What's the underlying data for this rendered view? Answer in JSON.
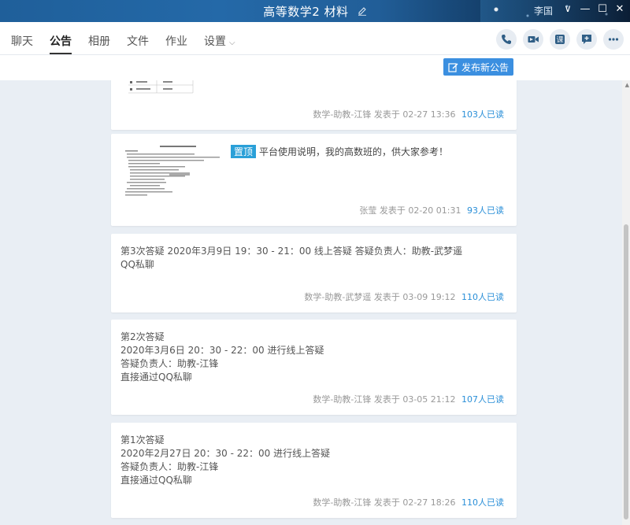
{
  "window": {
    "title": "高等数学2 材料",
    "user": "李国",
    "controls": [
      "∨",
      "—",
      "☐",
      "✕"
    ]
  },
  "tabs": [
    {
      "label": "聊天"
    },
    {
      "label": "公告"
    },
    {
      "label": "相册"
    },
    {
      "label": "文件"
    },
    {
      "label": "作业"
    },
    {
      "label": "设置"
    }
  ],
  "actions": [
    "phone-icon",
    "video-icon",
    "course-icon",
    "add-comment-icon",
    "more-icon"
  ],
  "publish": {
    "label": "发布新公告"
  },
  "colors": {
    "accent": "#3b8fe0",
    "reads": "#2a8fd8",
    "pinned": "#2aa0d8"
  },
  "announcements": [
    {
      "author": "数学-助教-江锋",
      "time": "发表于 02-27 13:36",
      "reads": "103人已读"
    },
    {
      "pinned_label": "置顶",
      "text": "平台使用说明，我的高数班的，供大家参考！",
      "author": "张莹",
      "time": "发表于 02-20 01:31",
      "reads": "93人已读"
    },
    {
      "lines": [
        "第3次答疑 2020年3月9日 19：30 - 21：00 线上答疑 答疑负责人：助教-武梦遥",
        "QQ私聊"
      ],
      "author": "数学-助教-武梦遥",
      "time": "发表于 03-09 19:12",
      "reads": "110人已读"
    },
    {
      "lines": [
        "第2次答疑",
        "2020年3月6日 20：30 - 22：00 进行线上答疑",
        "答疑负责人：助教-江锋",
        "直接通过QQ私聊"
      ],
      "author": "数学-助教-江锋",
      "time": "发表于 03-05 21:12",
      "reads": "107人已读"
    },
    {
      "lines": [
        "第1次答疑",
        "2020年2月27日 20：30 - 22：00 进行线上答疑",
        "答疑负责人：助教-江锋",
        "直接通过QQ私聊"
      ],
      "author": "数学-助教-江锋",
      "time": "发表于 02-27 18:26",
      "reads": "110人已读"
    }
  ]
}
